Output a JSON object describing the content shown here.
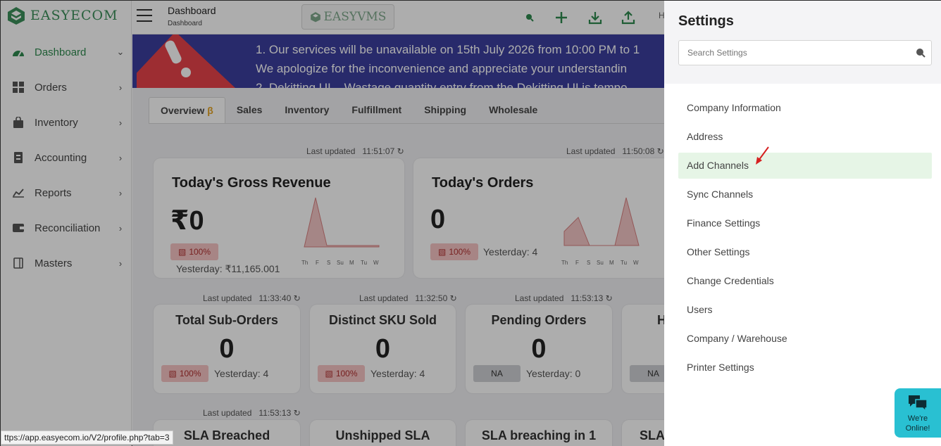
{
  "brand": {
    "name": "EASYECOM",
    "vms_label": "EASYVMS"
  },
  "header": {
    "title": "Dashboard",
    "breadcrumb": "Dashboard",
    "user_initial": "H"
  },
  "sidebar": {
    "items": [
      {
        "label": "Dashboard",
        "icon": "gauge-icon",
        "active": true
      },
      {
        "label": "Orders",
        "icon": "grid-icon"
      },
      {
        "label": "Inventory",
        "icon": "bag-icon"
      },
      {
        "label": "Accounting",
        "icon": "ledger-icon"
      },
      {
        "label": "Reports",
        "icon": "chart-icon"
      },
      {
        "label": "Reconciliation",
        "icon": "wallet-icon"
      },
      {
        "label": "Masters",
        "icon": "book-icon"
      }
    ]
  },
  "banner": {
    "lines": [
      "1. Our services will be unavailable on 15th July 2026 from 10:00 PM to 1",
      "We apologize for the inconvenience and appreciate your understandin",
      "2. Dekitting UI – Wastage quantity entry from the Dekitting UI is tempo"
    ]
  },
  "tabs": [
    {
      "label": "Overview",
      "beta": "β"
    },
    {
      "label": "Sales"
    },
    {
      "label": "Inventory"
    },
    {
      "label": "Fulfillment"
    },
    {
      "label": "Shipping"
    },
    {
      "label": "Wholesale"
    }
  ],
  "cards_large": [
    {
      "updated_label": "Last updated",
      "updated_time": "11:51:07",
      "title": "Today's Gross Revenue",
      "value": "₹0",
      "badge": "100%",
      "yesterday": "Yesterday: ₹11,165.001",
      "spark_days": [
        "Th",
        "F",
        "S",
        "Su",
        "M",
        "Tu",
        "W"
      ]
    },
    {
      "updated_label": "Last updated",
      "updated_time": "11:50:08",
      "title": "Today's Orders",
      "value": "0",
      "badge": "100%",
      "yesterday": "Yesterday: 4",
      "spark_days": [
        "Th",
        "F",
        "S",
        "Su",
        "M",
        "Tu",
        "W"
      ]
    }
  ],
  "cards_small": [
    {
      "updated_label": "Last updated",
      "updated_time": "11:33:40",
      "title": "Total Sub-Orders",
      "value": "0",
      "badge": "100%",
      "badge_type": "red",
      "yesterday": "Yesterday: 4"
    },
    {
      "updated_label": "Last updated",
      "updated_time": "11:32:50",
      "title": "Distinct SKU Sold",
      "value": "0",
      "badge": "100%",
      "badge_type": "red",
      "yesterday": "Yesterday: 4"
    },
    {
      "updated_label": "Last updated",
      "updated_time": "11:53:13",
      "title": "Pending Orders",
      "value": "0",
      "badge": "NA",
      "badge_type": "gray",
      "yesterday": "Yesterday: 0"
    },
    {
      "title": "H",
      "badge": "NA",
      "badge_type": "gray"
    }
  ],
  "cards_row3": {
    "updated_label": "Last updated",
    "updated_time": "11:53:13",
    "titles": [
      "SLA Breached",
      "Unshipped SLA",
      "SLA breaching in 1",
      "SLA"
    ]
  },
  "settings": {
    "title": "Settings",
    "search_placeholder": "Search Settings",
    "items": [
      "Company Information",
      "Address",
      "Add Channels",
      "Sync Channels",
      "Finance Settings",
      "Other Settings",
      "Change Credentials",
      "Users",
      "Company / Warehouse",
      "Printer Settings"
    ],
    "highlighted_index": 2
  },
  "chat": {
    "line1": "We're",
    "line2": "Online!"
  },
  "status_url": "ttps://app.easyecom.io/V2/profile.php?tab=3",
  "colors": {
    "brand_green": "#3b8f5a",
    "banner": "#3c3f9e",
    "highlight": "#e6f5e6",
    "chat": "#29c0d2",
    "badge_red": "#f7c4c4"
  }
}
